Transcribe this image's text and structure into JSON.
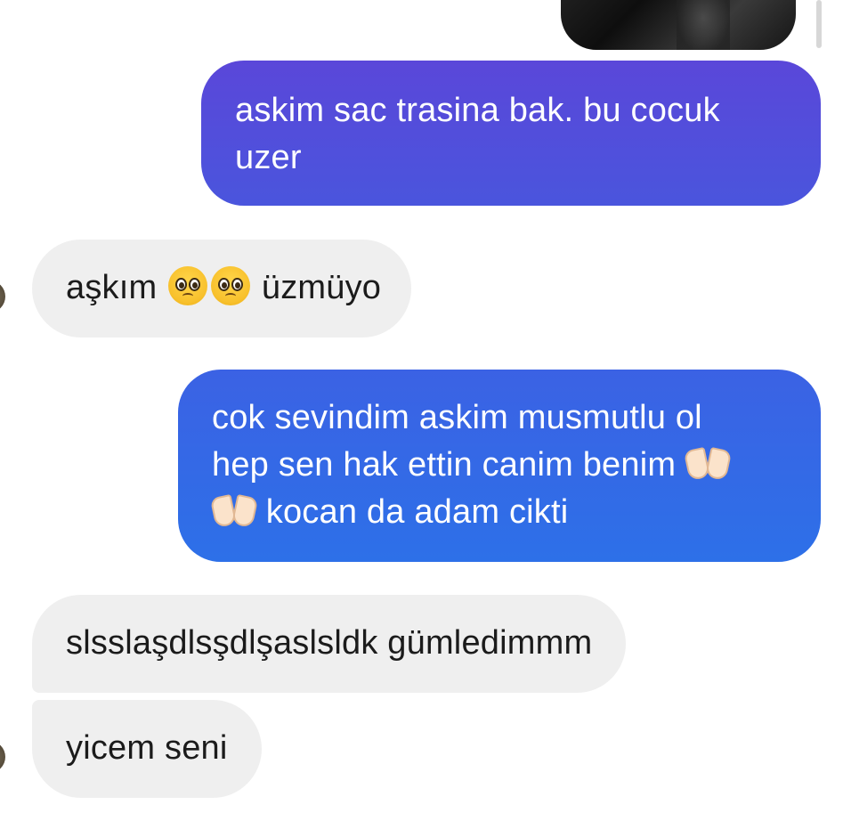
{
  "messages": [
    {
      "direction": "outgoing",
      "lines": [
        "askim sac trasina bak. bu cocuk",
        "uzer"
      ]
    },
    {
      "direction": "incoming",
      "text_before": "aşkım",
      "emoji": [
        "pleading-face",
        "pleading-face"
      ],
      "text_after": "üzmüyo"
    },
    {
      "direction": "outgoing",
      "lines": [
        "cok sevindim askim musmutlu ol",
        "hep sen hak ettin canim benim",
        "kocan da adam cikti"
      ],
      "emoji": [
        "palms-up-together",
        "palms-up-together"
      ]
    },
    {
      "direction": "incoming",
      "text": "slsslaşdlsşdlşaslsldk gümledimmm"
    },
    {
      "direction": "incoming",
      "text": "yicem seni"
    }
  ],
  "colors": {
    "outgoing_purple": "#5a47d9",
    "outgoing_blue": "#2d70e8",
    "incoming_bg": "#efefef",
    "incoming_text": "#1b1b1b"
  }
}
